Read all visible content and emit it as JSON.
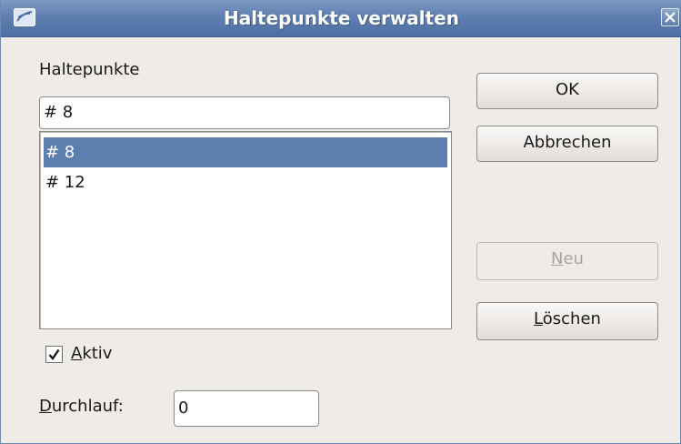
{
  "window": {
    "title": "Haltepunkte verwalten",
    "icons": {
      "app": "app-logo-icon",
      "close": "close-icon"
    }
  },
  "breakpoints": {
    "label": "Haltepunkte",
    "current_value": "# 8",
    "items": [
      {
        "label": "# 8",
        "selected": true
      },
      {
        "label": "# 12",
        "selected": false
      }
    ]
  },
  "buttons": {
    "ok": "OK",
    "cancel": "Abbrechen",
    "new_mnemonic": "N",
    "new_rest": "eu",
    "delete_mnemonic": "L",
    "delete_rest": "öschen"
  },
  "active": {
    "checked": true,
    "label_mnemonic": "A",
    "label_rest": "ktiv"
  },
  "pass": {
    "label_mnemonic": "D",
    "label_rest": "urchlauf:",
    "value": "0"
  },
  "colors": {
    "selection": "#5b7faf",
    "titlebar": "#5f7fb0",
    "dialog_bg": "#efebe7"
  }
}
